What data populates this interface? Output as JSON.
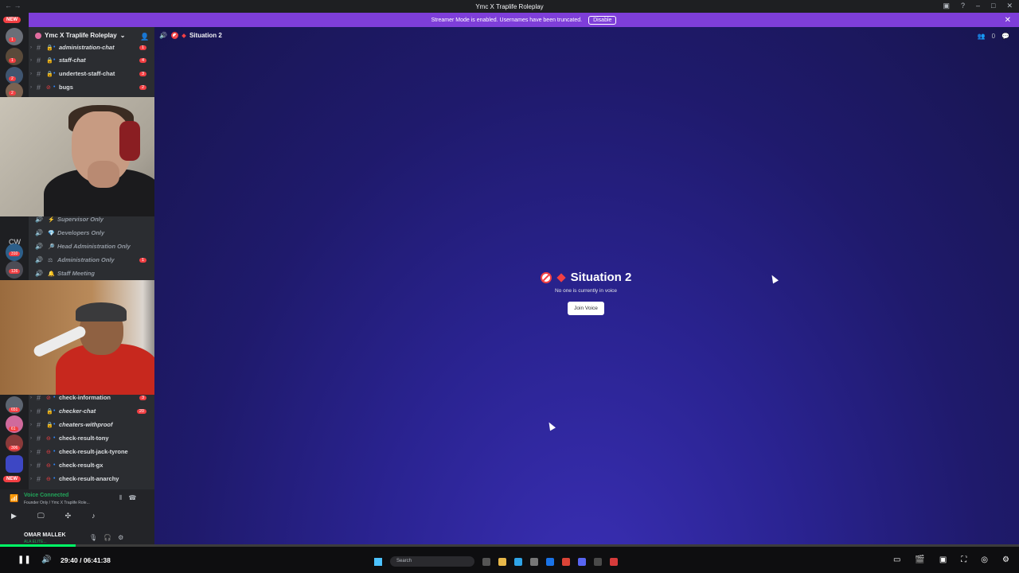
{
  "window": {
    "title": "Ymc X Traplife Roleplay"
  },
  "banner": {
    "text": "Streamer Mode is enabled. Usernames have been truncated.",
    "button": "Disable"
  },
  "guilds": {
    "new_badge": "NEW",
    "cw_label": "CW",
    "badges": [
      "1",
      "1",
      "2",
      "2",
      "310",
      "126",
      "651",
      "61",
      "306"
    ]
  },
  "server": {
    "name": "Ymc X Traplife Roleplay"
  },
  "channels_top": [
    {
      "name": "administration-chat",
      "count": "1",
      "italic": true
    },
    {
      "name": "staff-chat",
      "count": "4",
      "italic": true
    },
    {
      "name": "undertest-staff-chat",
      "count": "3",
      "italic": false
    },
    {
      "name": "bugs",
      "count": "2",
      "italic": false
    }
  ],
  "voice_channels": [
    {
      "name": "Supervisor Only",
      "emoji": "⚡",
      "count": ""
    },
    {
      "name": "Developers Only",
      "emoji": "💎",
      "count": ""
    },
    {
      "name": "Head Administration Only",
      "emoji": "🔎",
      "count": ""
    },
    {
      "name": "Administration Only",
      "emoji": "⚖",
      "count": "1"
    },
    {
      "name": "Staff Meeting",
      "emoji": "🔔",
      "count": ""
    }
  ],
  "channels_bottom": [
    {
      "name": "check-information",
      "count": "3",
      "italic": false
    },
    {
      "name": "checker-chat",
      "count": "20",
      "italic": true
    },
    {
      "name": "cheaters-withproof",
      "count": "",
      "italic": true
    },
    {
      "name": "check-result-tony",
      "count": "",
      "italic": false
    },
    {
      "name": "check-result-jack-tyrone",
      "count": "",
      "italic": false
    },
    {
      "name": "check-result-gx",
      "count": "",
      "italic": false
    },
    {
      "name": "check-result-anarchy",
      "count": "",
      "italic": false
    }
  ],
  "header": {
    "channel": "Situation 2",
    "member_count": "0"
  },
  "empty_voice": {
    "title": "Situation 2",
    "subtitle": "No one is currently in voice",
    "join_label": "Join Voice"
  },
  "voice_panel": {
    "status": "Voice Connected",
    "location": "Founder Only / Ymc X Traplife Role...",
    "username": "OMAR MALLEK",
    "user_status": "ALA ELITE..."
  },
  "player": {
    "time": "29:40 / 06:41:38",
    "progress": 0.074
  },
  "taskbar": {
    "search": "Search"
  },
  "colors": {
    "accent": "#7e3ed9",
    "danger": "#f23f43",
    "online": "#23a55a",
    "progress": "#00ff66"
  }
}
